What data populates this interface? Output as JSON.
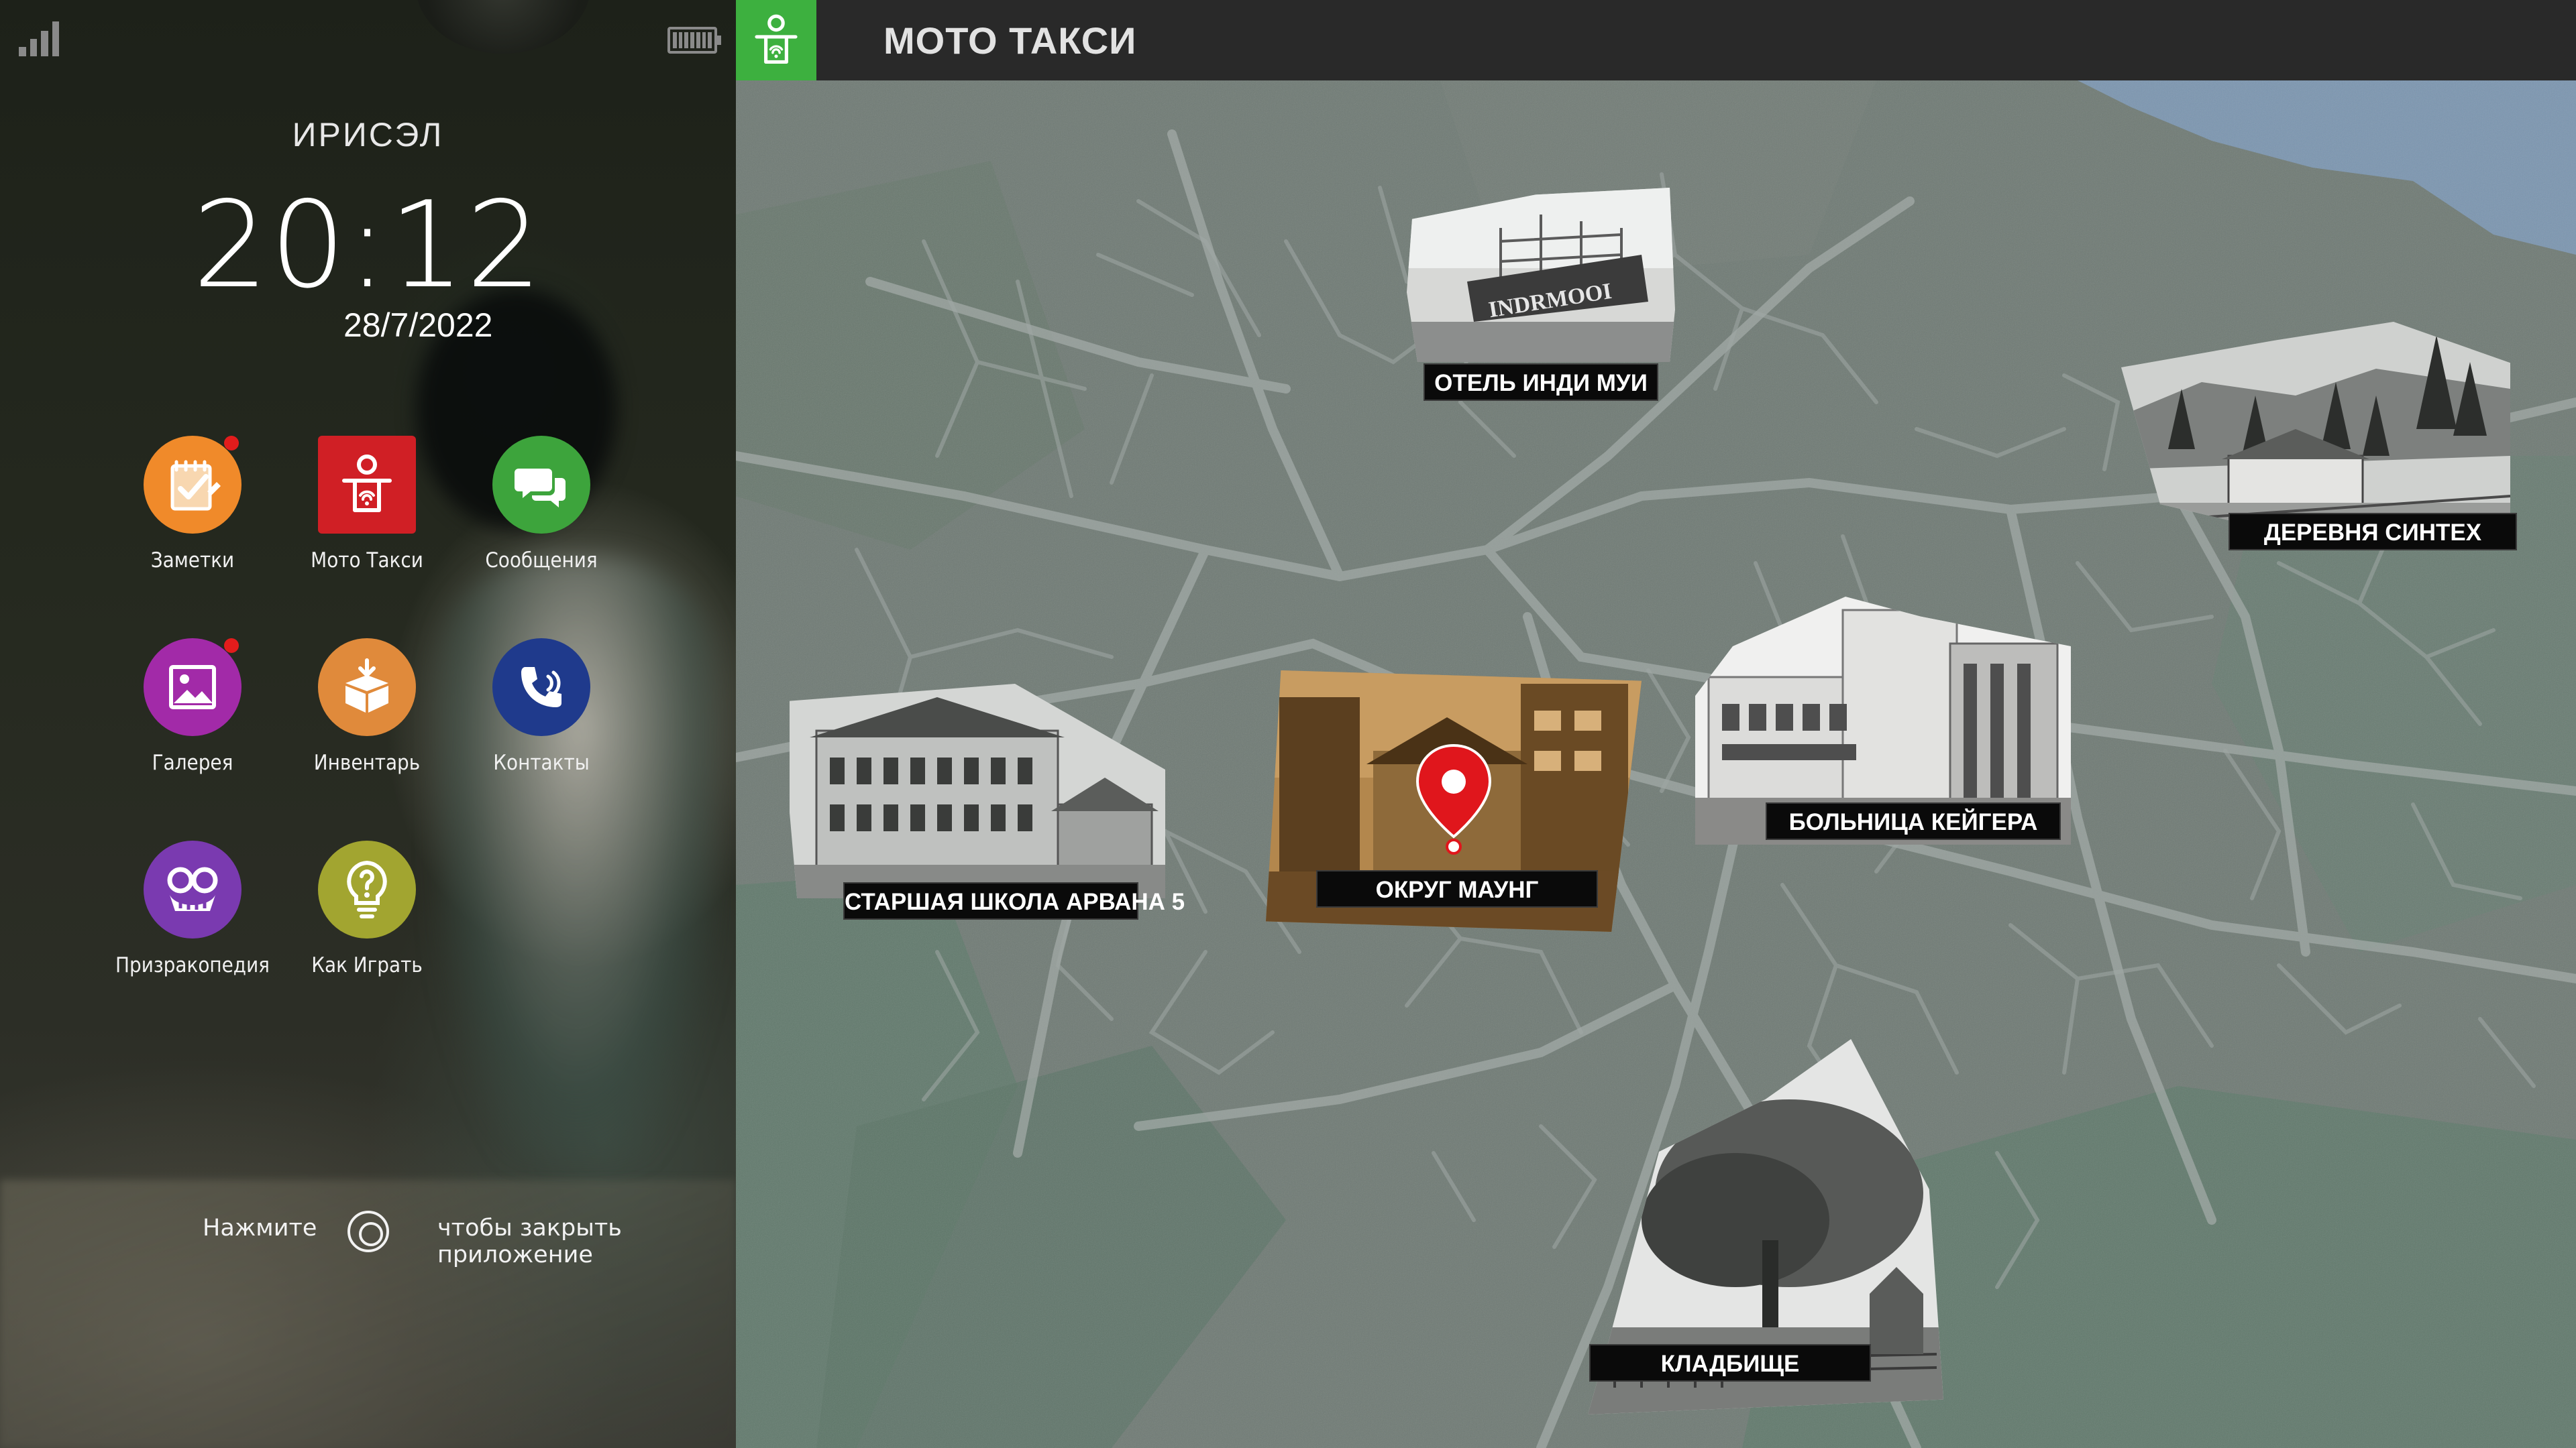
{
  "phone": {
    "device_name": "ИРИСЭЛ",
    "time": "20:12",
    "date": "28/7/2022",
    "status": {
      "signal_icon": "signal-bars-icon",
      "battery_icon": "battery-icon"
    },
    "apps": [
      {
        "id": "notes",
        "label": "Заметки",
        "icon": "notes-icon",
        "color": "#f08a2a",
        "badge": true
      },
      {
        "id": "moto-taxi",
        "label": "Мото Такси",
        "icon": "moto-taxi-icon",
        "color": "#d01f25",
        "badge": false
      },
      {
        "id": "messages",
        "label": "Сообщения",
        "icon": "chat-bubbles-icon",
        "color": "#3da43c",
        "badge": false
      },
      {
        "id": "gallery",
        "label": "Галерея",
        "icon": "picture-icon",
        "color": "#a22aa8",
        "badge": true
      },
      {
        "id": "inventory",
        "label": "Инвентарь",
        "icon": "box-icon",
        "color": "#e08a3b",
        "badge": false
      },
      {
        "id": "contacts",
        "label": "Контакты",
        "icon": "phone-icon",
        "color": "#1f3a8c",
        "badge": false
      },
      {
        "id": "ghostpedia",
        "label": "Призракопедия",
        "icon": "ghost-mask-icon",
        "color": "#7a3ab0",
        "badge": false
      },
      {
        "id": "how-to-play",
        "label": "Как Играть",
        "icon": "lightbulb-icon",
        "color": "#a2a530",
        "badge": false
      }
    ],
    "close_hint": {
      "press": "Нажмите",
      "button_icon": "circle-button-icon",
      "action": "чтобы закрыть приложение"
    }
  },
  "app": {
    "title": "МОТО ТАКСИ",
    "header_icon": "moto-taxi-icon",
    "accent": "#3db03f",
    "pin_color": "#e0161c",
    "locations": [
      {
        "id": "hotel",
        "label": "ОТЕЛЬ ИНДИ МУИ",
        "sign_text": "INDRMOOI",
        "selected": false
      },
      {
        "id": "village",
        "label": "ДЕРЕВНЯ СИНТЕХ",
        "selected": false
      },
      {
        "id": "hospital",
        "label": "БОЛЬНИЦА КЕЙГЕРА",
        "selected": false
      },
      {
        "id": "district",
        "label": "ОКРУГ МАУНГ",
        "selected": true
      },
      {
        "id": "school",
        "label": "СТАРШАЯ ШКОЛА АРВАНА 5",
        "selected": false
      },
      {
        "id": "cemetery",
        "label": "КЛАДБИЩЕ",
        "selected": false
      }
    ]
  }
}
